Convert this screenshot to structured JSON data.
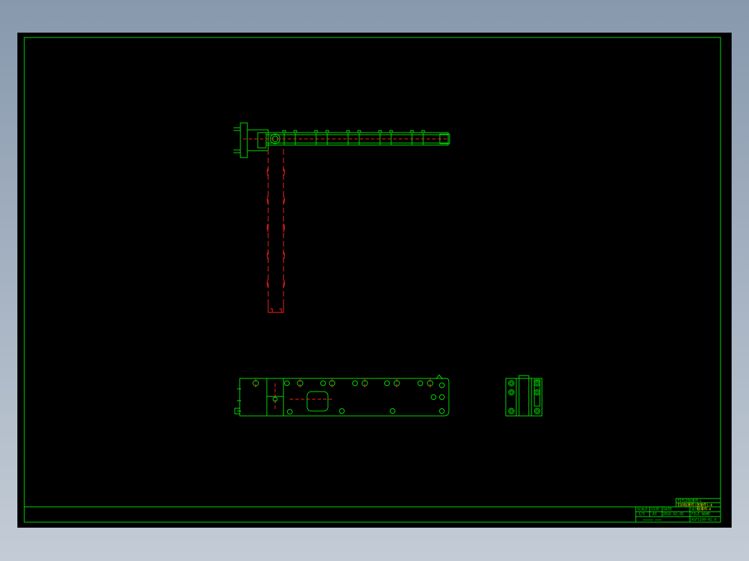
{
  "drawing": {
    "background": "#000000",
    "frame_color": "#00e000",
    "hidden_line_color": "#ff2020"
  },
  "title_block": {
    "title_1": "TITLE标准件—Ⅰ",
    "title_2": "ISO标准件(连接件)—Ⅱ",
    "scale_label": "SCALE",
    "scale_value": "1/5",
    "size_label": "SIZE",
    "size_value": "A3",
    "date_label": "DATE",
    "date_value": "2016.02.05",
    "drawn_label": "设计：",
    "drawn_value": "标准件—Ⅱ",
    "file_label": "FILE NAME",
    "file_value": "ASF1100—01.0",
    "company": "▭▭▭▭▭ ▭▭▭"
  }
}
